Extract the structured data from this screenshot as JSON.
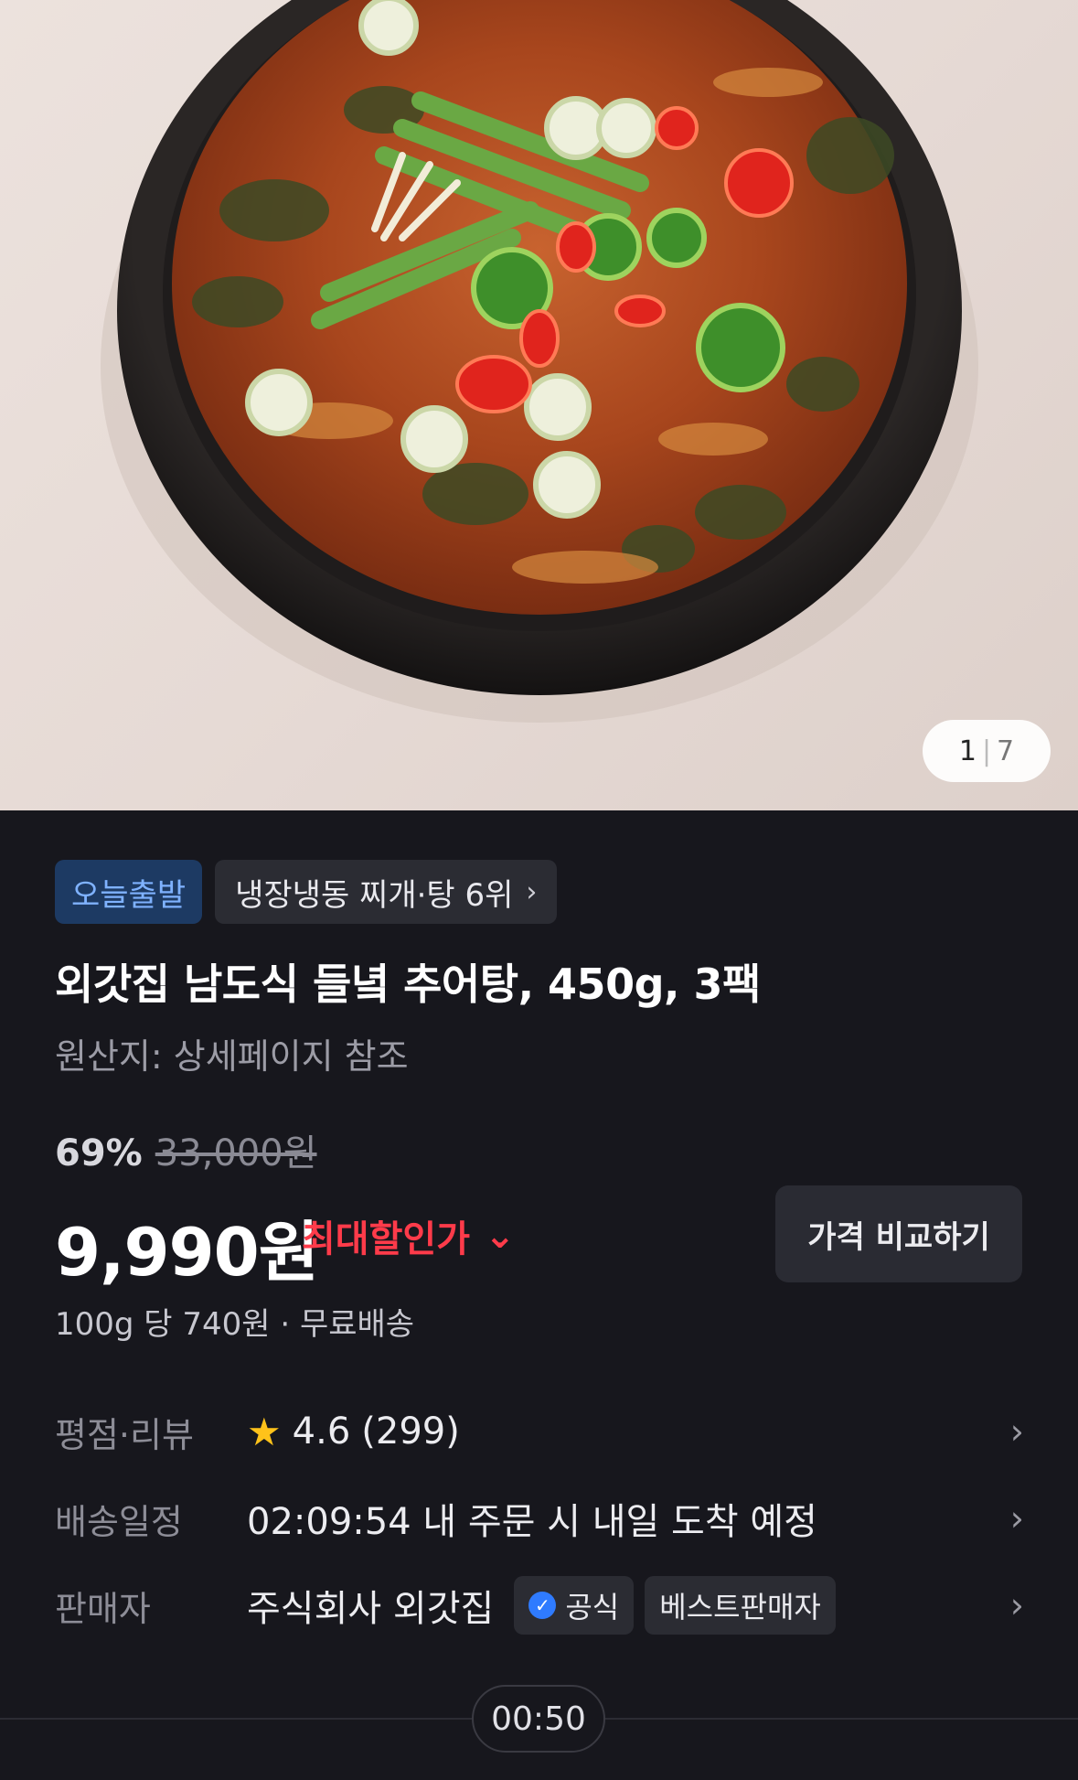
{
  "hero": {
    "page_current": "1",
    "page_total": "7"
  },
  "badges": {
    "today": "오늘출발",
    "rank": "냉장냉동 찌개·탕 6위",
    "rank_chevron": "›"
  },
  "product": {
    "title": "외갓집 남도식 들녘 추어탕, 450g, 3팩",
    "origin": "원산지: 상세페이지 참조"
  },
  "pricing": {
    "discount_percent": "69%",
    "original_price": "33,000원",
    "price": "9,990원",
    "max_discount_label": "최대할인가",
    "max_discount_chevron": "⌄",
    "compare_button": "가격 비교하기",
    "unit_info": "100g 당 740원 · 무료배송"
  },
  "rating": {
    "label": "평점·리뷰",
    "score": "4.6",
    "count": "(299)"
  },
  "delivery": {
    "label": "배송일정",
    "text": "02:09:54 내 주문 시 내일 도착 예정"
  },
  "seller": {
    "label": "판매자",
    "name": "주식회사 외갓집",
    "official_tag": "공식",
    "best_tag": "베스트판매자"
  },
  "timer": "00:50",
  "colors": {
    "background": "#17171d",
    "discount_red": "#ff3b4a",
    "today_badge": "#7fb2ff",
    "star": "#ffc21a"
  },
  "icons": {
    "star": "star-icon",
    "check": "verified-check-icon",
    "chevron": "chevron-right-icon"
  }
}
